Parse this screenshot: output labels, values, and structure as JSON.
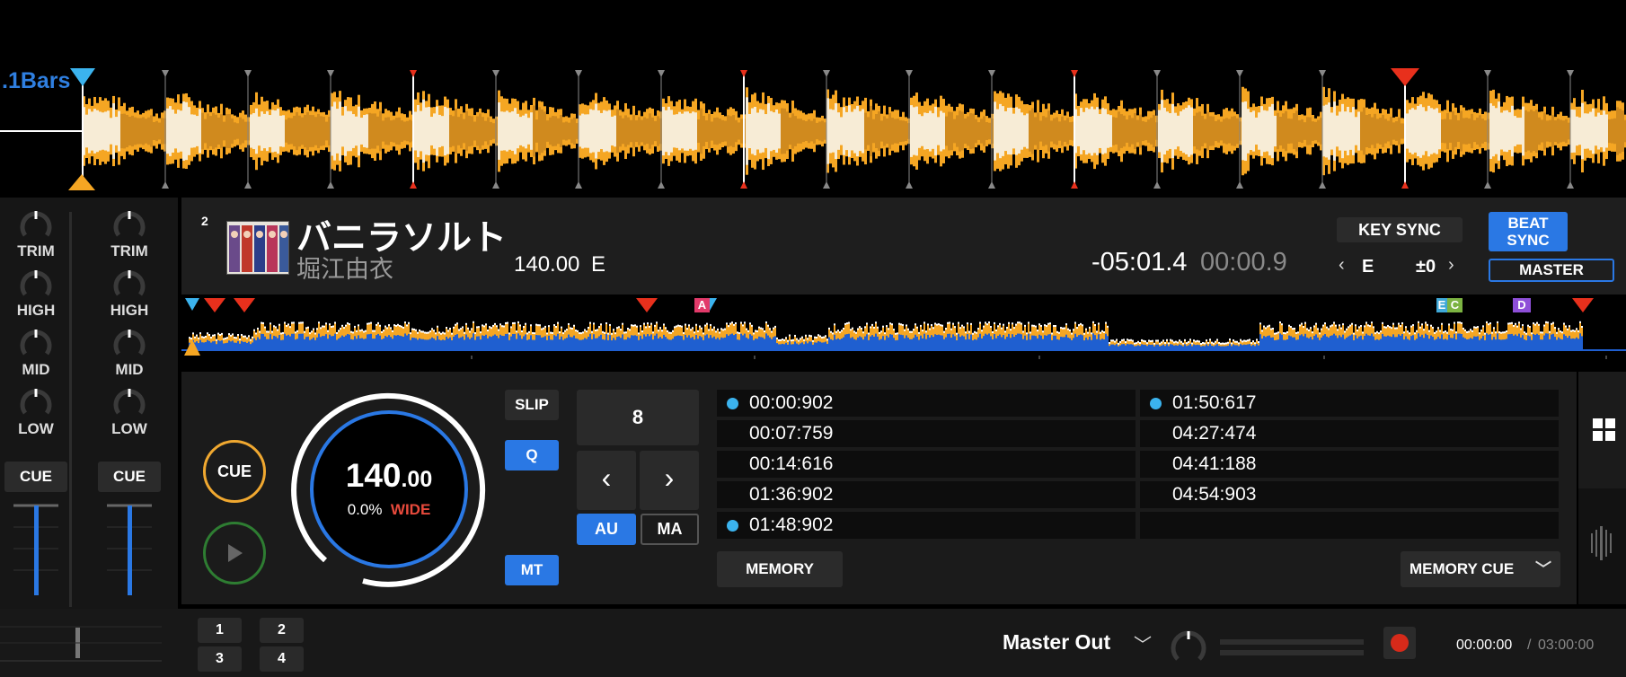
{
  "overview": {
    "bars_label": ".1Bars"
  },
  "mixer": {
    "knobs": [
      "TRIM",
      "HIGH",
      "MID",
      "LOW"
    ],
    "cue_left": "CUE",
    "cue_right": "CUE"
  },
  "deck": {
    "number": "2",
    "title": "バニラソルト",
    "artist": "堀江由衣",
    "bpm_key": "140.00",
    "key": "E",
    "remaining_time": "-05:01.4",
    "elapsed_time": "00:00.9",
    "key_sync_label": "KEY SYNC",
    "key_value": "E",
    "key_shift": "±0",
    "beat_sync_label": "BEAT SYNC",
    "master_label": "MASTER"
  },
  "mini_markers": {
    "a": "A",
    "e": "E",
    "c": "C",
    "d": "D"
  },
  "controls": {
    "cue_button": "CUE",
    "tempo_int": "140",
    "tempo_dec": ".00",
    "pitch": "0.0%",
    "range": "WIDE",
    "slip_label": "SLIP",
    "q_label": "Q",
    "mt_label": "MT",
    "beat_jump_value": "8",
    "au_label": "AU",
    "ma_label": "MA",
    "memory_label": "MEMORY",
    "memory_cue_label": "MEMORY CUE"
  },
  "cue_list": {
    "left": [
      {
        "time": "00:00:902",
        "dot": true
      },
      {
        "time": "00:07:759",
        "dot": false
      },
      {
        "time": "00:14:616",
        "dot": false
      },
      {
        "time": "01:36:902",
        "dot": false
      },
      {
        "time": "01:48:902",
        "dot": true
      }
    ],
    "right": [
      {
        "time": "01:50:617",
        "dot": true
      },
      {
        "time": "04:27:474",
        "dot": false
      },
      {
        "time": "04:41:188",
        "dot": false
      },
      {
        "time": "04:54:903",
        "dot": false
      },
      {
        "time": "",
        "dot": false
      }
    ]
  },
  "bottom": {
    "pads": [
      "1",
      "2",
      "3",
      "4"
    ],
    "output_label": "Master Out",
    "rec_time": "00:00:00",
    "rec_sep": "/",
    "rec_total": "03:00:00"
  },
  "colors": {
    "accent": "#2a78e4",
    "wave_orange": "#f5a623",
    "wave_cream": "#f7ecd6",
    "cue_blue": "#3bb3ee",
    "marker_red": "#e8301c"
  }
}
